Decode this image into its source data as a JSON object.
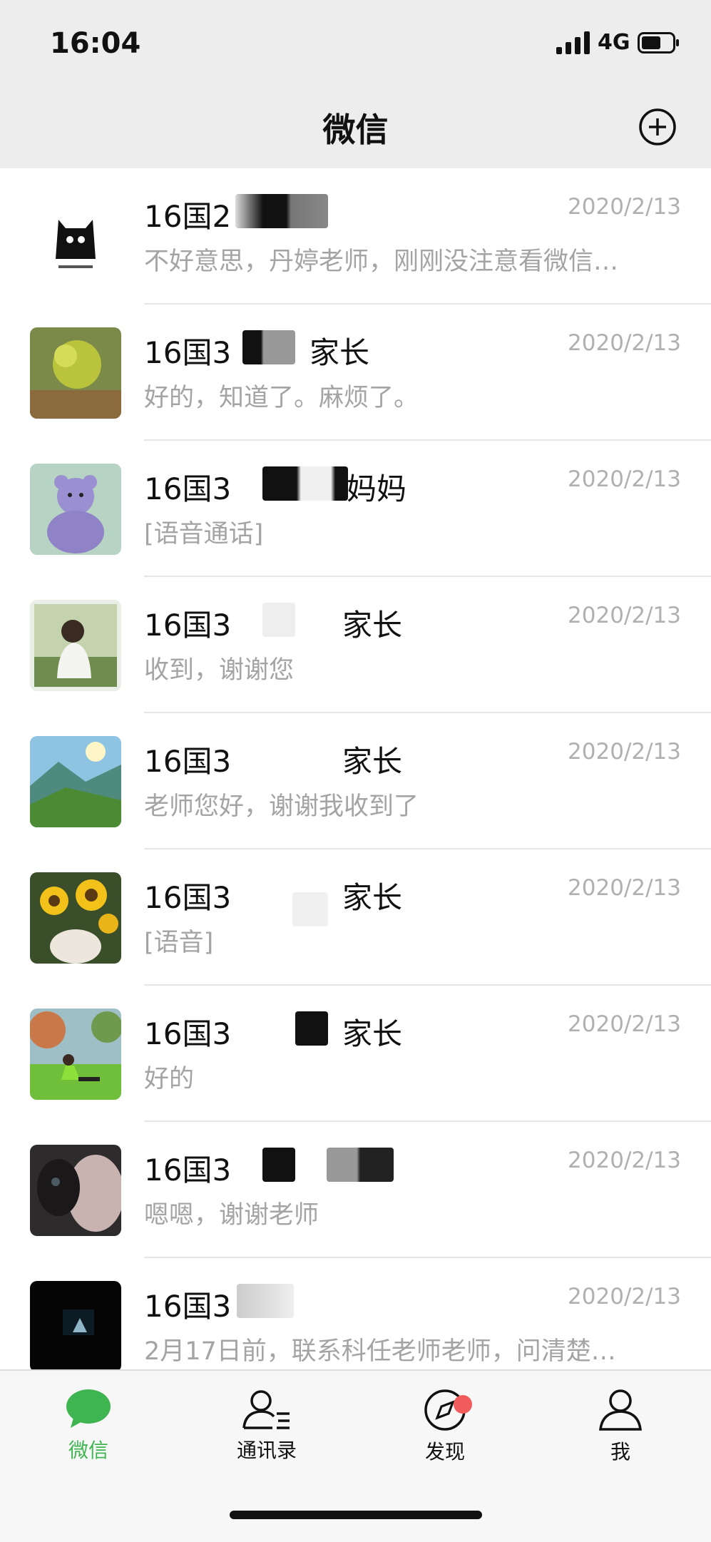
{
  "status_bar": {
    "time": "16:04",
    "network": "4G"
  },
  "header": {
    "title": "微信"
  },
  "chats": [
    {
      "name": "16国2",
      "date": "2020/2/13",
      "preview": "不好意思，丹婷老师，刚刚没注意看微信…"
    },
    {
      "name": "16国3",
      "name_suffix": "家长",
      "date": "2020/2/13",
      "preview": "好的，知道了。麻烦了。"
    },
    {
      "name": "16国3",
      "name_suffix": "妈妈",
      "date": "2020/2/13",
      "preview": "[语音通话]"
    },
    {
      "name": "16国3",
      "name_suffix": "家长",
      "date": "2020/2/13",
      "preview": "收到，谢谢您"
    },
    {
      "name": "16国3",
      "name_suffix": "家长",
      "date": "2020/2/13",
      "preview": "老师您好，谢谢我收到了"
    },
    {
      "name": "16国3",
      "name_suffix": "家长",
      "date": "2020/2/13",
      "preview": "[语音]"
    },
    {
      "name": "16国3",
      "name_suffix": "家长",
      "date": "2020/2/13",
      "preview": "好的"
    },
    {
      "name": "16国3",
      "date": "2020/2/13",
      "preview": "嗯嗯，谢谢老师"
    },
    {
      "name": "16国3",
      "date": "2020/2/13",
      "preview": "2月17日前，联系科任老师老师，问清楚…"
    }
  ],
  "tabs": [
    {
      "label": "微信",
      "icon": "chat-bubble-icon",
      "active": true
    },
    {
      "label": "通讯录",
      "icon": "contacts-icon"
    },
    {
      "label": "发现",
      "icon": "compass-icon",
      "badge": true
    },
    {
      "label": "我",
      "icon": "person-icon"
    }
  ],
  "colors": {
    "accent": "#3fb551",
    "badge": "#f15b5b",
    "header_bg": "#ededed"
  }
}
